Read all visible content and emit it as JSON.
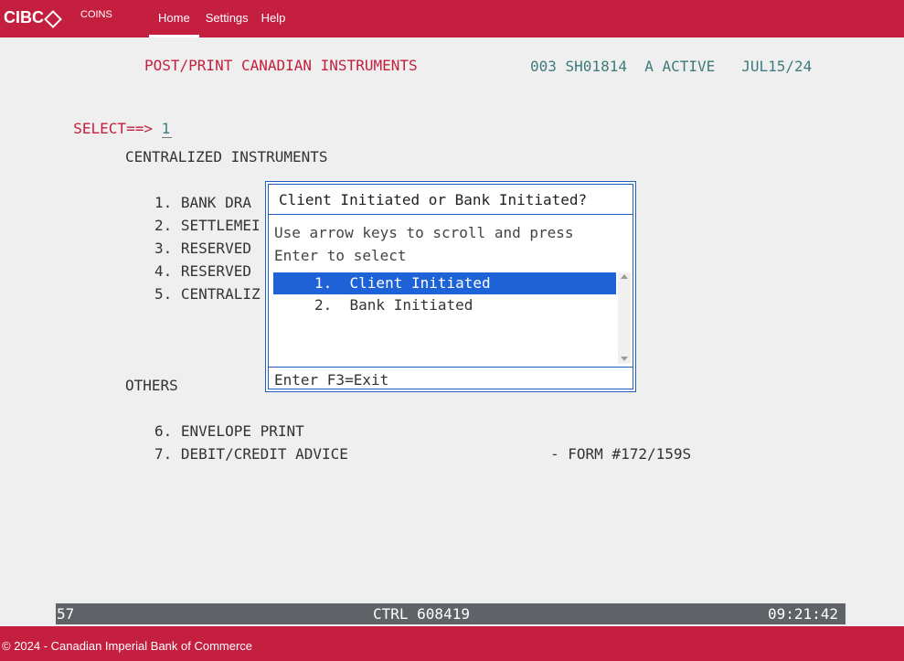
{
  "app": {
    "logo_text": "CIBC",
    "product": "COINS",
    "nav": [
      "Home",
      "Settings",
      "Help"
    ]
  },
  "screen": {
    "title": "POST/PRINT CANADIAN INSTRUMENTS",
    "header_info": "003 SH01814  A ACTIVE   JUL15/24",
    "select_label": "SELECT==>",
    "select_value": "1",
    "section1": "CENTRALIZED INSTRUMENTS",
    "items_left": [
      "1. BANK DRA",
      "2. SETTLEMEI",
      "3. RESERVED",
      "4. RESERVED",
      "5. CENTRALIZ"
    ],
    "section2": "OTHERS",
    "item6": "6. ENVELOPE PRINT",
    "item7": "7. DEBIT/CREDIT ADVICE",
    "item7_form": "- FORM #172/159S"
  },
  "dialog": {
    "title": "Client Initiated or Bank Initiated?",
    "help_line1": "Use arrow keys to scroll and press",
    "help_line2": "Enter to select",
    "options": [
      "1.  Client Initiated",
      "2.  Bank Initiated"
    ],
    "selected_index": 0,
    "footer": "Enter F3=Exit"
  },
  "status": {
    "left": "57",
    "center": "CTRL 608419",
    "right": "09:21:42"
  },
  "footer": {
    "text": "© 2024 - Canadian Imperial Bank of Commerce"
  }
}
